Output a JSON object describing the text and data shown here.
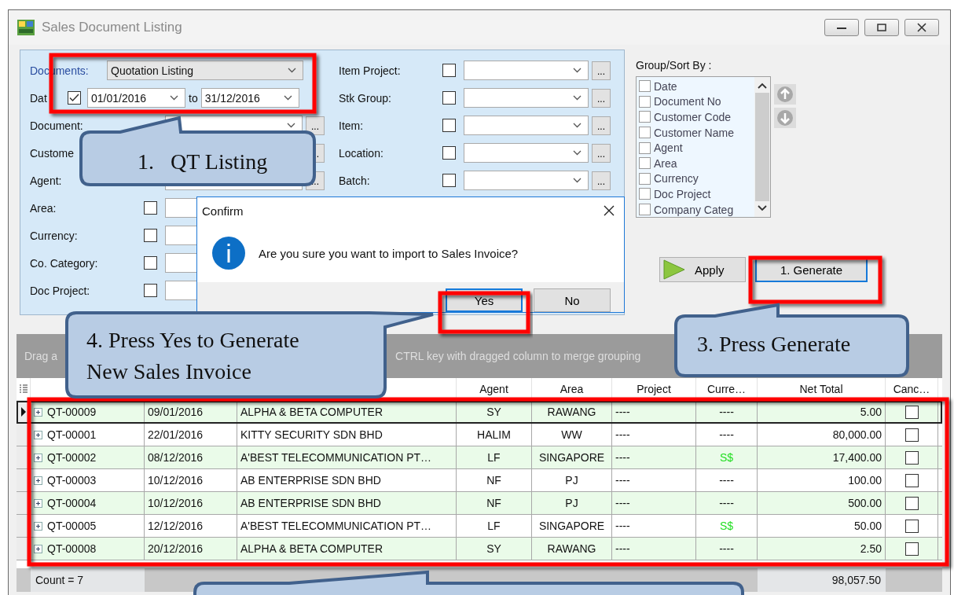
{
  "window": {
    "title": "Sales Document Listing"
  },
  "filters": {
    "documents": {
      "label": "Documents:",
      "value": "Quotation Listing"
    },
    "date": {
      "label": "Dat",
      "checked": true,
      "from": "01/01/2016",
      "to_label": "to",
      "to": "31/12/2016"
    },
    "left": [
      {
        "label": "Document:",
        "kind": "full",
        "button": "..."
      },
      {
        "label": "Custome",
        "kind": "under",
        "button": "."
      },
      {
        "label": "Agent:",
        "kind": "full",
        "button": "..."
      },
      {
        "label": "Area:",
        "checked": false,
        "kind": "cut"
      },
      {
        "label": "Currency:",
        "checked": false,
        "kind": "cut"
      },
      {
        "label": "Co. Category:",
        "checked": false,
        "kind": "cut"
      },
      {
        "label": "Doc Project:",
        "checked": false,
        "kind": "cut"
      }
    ],
    "middle": [
      {
        "label": "Item Project:",
        "checked": false,
        "button": "..."
      },
      {
        "label": "Stk Group:",
        "checked": false,
        "button": "..."
      },
      {
        "label": "Item:",
        "checked": false,
        "button": "..."
      },
      {
        "label": "Location:",
        "checked": false,
        "button": "..."
      },
      {
        "label": "Batch:",
        "checked": false,
        "button": "..."
      }
    ]
  },
  "group_sort": {
    "label": "Group/Sort By :",
    "items": [
      {
        "label": "Date",
        "checked": false
      },
      {
        "label": "Document No",
        "checked": false
      },
      {
        "label": "Customer Code",
        "checked": false
      },
      {
        "label": "Customer Name",
        "checked": false
      },
      {
        "label": "Agent",
        "checked": false
      },
      {
        "label": "Area",
        "checked": false
      },
      {
        "label": "Currency",
        "checked": false
      },
      {
        "label": "Doc Project",
        "checked": false
      },
      {
        "label": "Company Categ",
        "checked": false
      }
    ]
  },
  "actions": [
    {
      "label": "Apply",
      "kind": "apply"
    },
    {
      "label": "1. Generate",
      "kind": "default"
    }
  ],
  "grid": {
    "group_hint": [
      "Drag a",
      "CTRL key with dragged column to merge grouping"
    ],
    "columns": [
      "",
      "",
      "",
      "Agent",
      "Area",
      "Project",
      "Curre…",
      "Net Total",
      "Canc…"
    ],
    "rows": [
      {
        "cells": [
          "QT-00009",
          "09/01/2016",
          "ALPHA & BETA COMPUTER",
          "SY",
          "RAWANG",
          "----",
          "----",
          "5.00"
        ],
        "cancelled": false,
        "selected": true
      },
      {
        "cells": [
          "QT-00001",
          "22/01/2016",
          "KITTY SECURITY SDN BHD",
          "HALIM",
          "WW",
          "----",
          "----",
          "80,000.00"
        ],
        "cancelled": false,
        "selected": false
      },
      {
        "cells": [
          "QT-00002",
          "08/12/2016",
          "A'BEST TELECOMMUNICATION PT…",
          "LF",
          "SINGAPORE",
          "----",
          {
            "text": "S$",
            "color": "#22dd22"
          },
          "17,400.00"
        ],
        "cancelled": false,
        "selected": false
      },
      {
        "cells": [
          "QT-00003",
          "10/12/2016",
          "AB ENTERPRISE SDN BHD",
          "NF",
          "PJ",
          "----",
          "----",
          "100.00"
        ],
        "cancelled": false,
        "selected": false
      },
      {
        "cells": [
          "QT-00004",
          "10/12/2016",
          "AB ENTERPRISE SDN BHD",
          "NF",
          "PJ",
          "----",
          "----",
          "500.00"
        ],
        "cancelled": false,
        "selected": false
      },
      {
        "cells": [
          "QT-00005",
          "12/12/2016",
          "A'BEST TELECOMMUNICATION PT…",
          "LF",
          "SINGAPORE",
          "----",
          {
            "text": "S$",
            "color": "#22dd22"
          },
          "50.00"
        ],
        "cancelled": false,
        "selected": false
      },
      {
        "cells": [
          "QT-00008",
          "20/12/2016",
          "ALPHA & BETA COMPUTER",
          "SY",
          "RAWANG",
          "----",
          "----",
          "2.50"
        ],
        "cancelled": false,
        "selected": false
      }
    ],
    "footer": {
      "count": "Count = 7",
      "net_total": "98,057.50"
    }
  },
  "dialog": {
    "title": "Confirm",
    "message": "Are you sure you want to import to Sales Invoice?",
    "buttons": [
      {
        "label": "Yes",
        "focused": true
      },
      {
        "label": "No",
        "focused": false
      }
    ]
  },
  "callouts": [
    {
      "text": "1.   QT Listing"
    },
    {
      "text": "4. Press Yes to Generate New Sales Invoice"
    },
    {
      "text": "3. Press Generate"
    }
  ]
}
